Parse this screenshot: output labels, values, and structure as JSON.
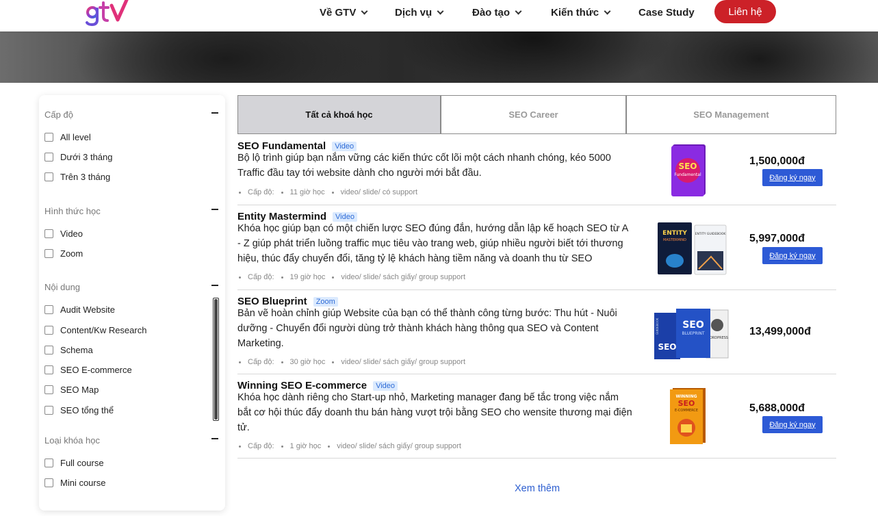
{
  "nav": {
    "items": [
      "Về GTV",
      "Dịch vụ",
      "Đào tạo",
      "Kiến thức",
      "Case Study"
    ],
    "contact": "Liên hệ"
  },
  "filters": {
    "level": {
      "title": "Cấp độ",
      "options": [
        "All level",
        "Dưới 3 tháng",
        "Trên 3 tháng"
      ]
    },
    "format": {
      "title": "Hình thức học",
      "options": [
        "Video",
        "Zoom"
      ]
    },
    "content": {
      "title": "Nội dung",
      "options": [
        "Audit Website",
        "Content/Kw Research",
        "Schema",
        "SEO E-commerce",
        "SEO Map",
        "SEO tổng thể"
      ]
    },
    "type": {
      "title": "Loại khóa học",
      "options": [
        "Full course",
        "Mini course"
      ]
    }
  },
  "tabs": [
    "Tất cả khoá học",
    "SEO Career",
    "SEO Management"
  ],
  "courses": [
    {
      "title": "SEO Fundamental",
      "badge": "Video",
      "desc": "Bộ lộ trình giúp bạn nắm vững các kiến thức cốt lõi một cách nhanh chóng, kéo 5000 Traffic đầu tay tới website dành cho người mới bắt đầu.",
      "level": "Cấp độ:",
      "hours": "11 giờ học",
      "materials": "video/ slide/ có support",
      "price": "1,500,000đ",
      "cta": "Đăng ký ngay"
    },
    {
      "title": "Entity Mastermind",
      "badge": "Video",
      "desc": "Khóa học giúp bạn có một chiến lược SEO đúng đắn, hướng dẫn lập kế hoạch SEO từ A - Z giúp phát triển luồng traffic mục tiêu vào trang web, giúp nhiều người biết tới thương hiệu, thúc đẩy chuyển đổi, tăng tỷ lệ khách hàng tiềm năng và doanh thu từ SEO",
      "level": "Cấp độ:",
      "hours": "19 giờ học",
      "materials": "video/ slide/ sách giấy/ group support",
      "price": "5,997,000đ",
      "cta": "Đăng ký ngay"
    },
    {
      "title": "SEO Blueprint",
      "badge": "Zoom",
      "desc": "Bản vẽ hoàn chỉnh giúp Website của bạn có thể thành công từng bước: Thu hút - Nuôi dưỡng - Chuyển đổi người dùng trở thành khách hàng thông qua SEO và Content Marketing.",
      "level": "Cấp độ:",
      "hours": "30 giờ học",
      "materials": "video/ slide/ sách giấy/ group support",
      "price": "13,499,000đ",
      "cta": ""
    },
    {
      "title": "Winning SEO E-commerce",
      "badge": "Video",
      "desc": "Khóa học dành riêng cho Start-up nhỏ, Marketing manager đang bế tắc trong việc nắm bắt cơ hội thúc đẩy doanh thu bán hàng vượt trội bằng SEO cho wensite thương mại điện tử.",
      "level": "Cấp độ:",
      "hours": "1 giờ học",
      "materials": "video/ slide/ sách giấy/ group support",
      "price": "5,688,000đ",
      "cta": "Đăng ký ngay"
    }
  ],
  "thumb_text": {
    "seo": "SEO",
    "fundamental": "Fundamental",
    "entity": "ENTITY",
    "mastermind": "MASTERMIND",
    "guidebook": "ENTITY GUIDEBOOK",
    "blueprint": "BLUEPRINT",
    "guidebook2": "GUIDEBOOK",
    "wordpress": "WORDPRESS",
    "winning": "WINNING",
    "ecommerce": "E-COMMERCE"
  },
  "more": "Xem thêm",
  "colors": {
    "brand_red": "#cc2128",
    "cta_blue": "#2d5ad6",
    "link_blue": "#2e5fd0",
    "badge_bg": "#dbeafe"
  }
}
